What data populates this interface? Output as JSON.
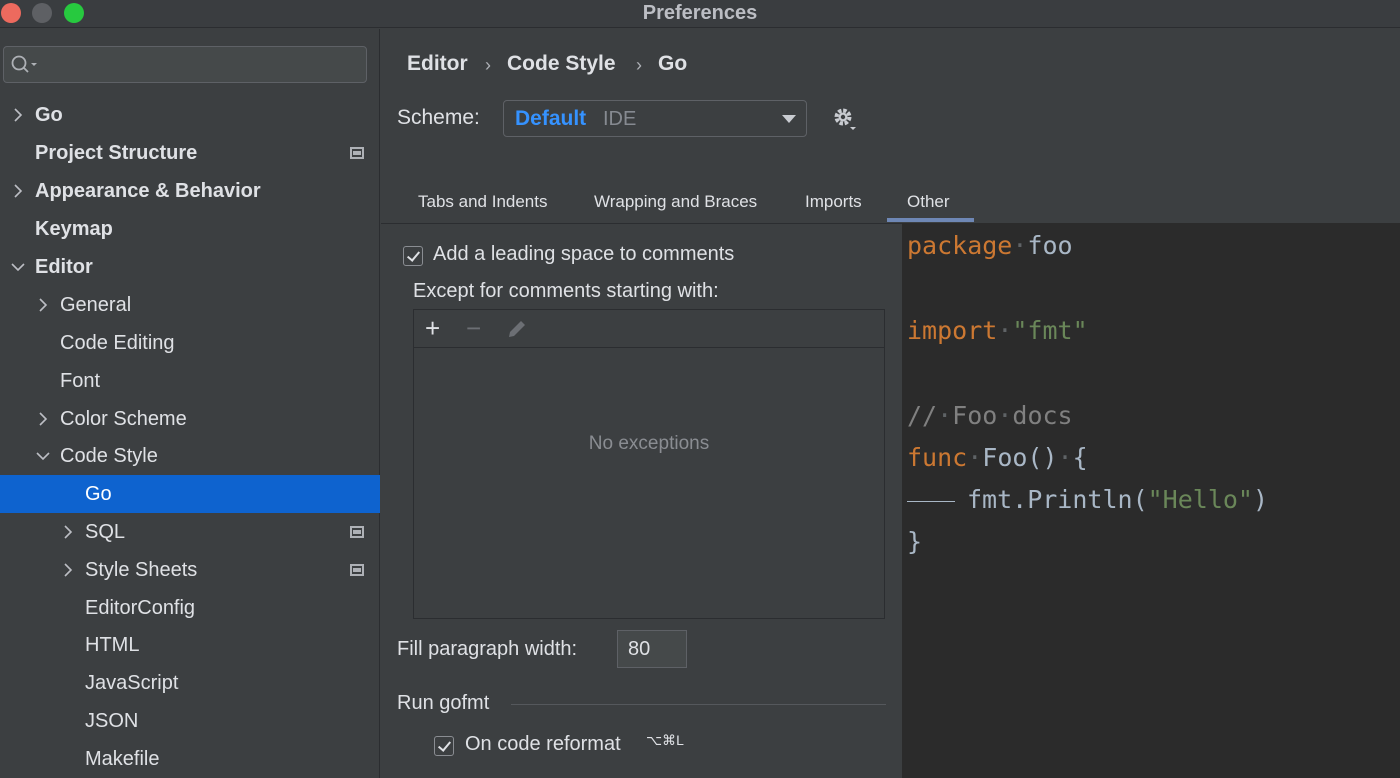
{
  "window": {
    "title": "Preferences"
  },
  "sidebar": {
    "search_placeholder": "",
    "items": [
      {
        "label": "Go"
      },
      {
        "label": "Project Structure"
      },
      {
        "label": "Appearance & Behavior"
      },
      {
        "label": "Keymap"
      },
      {
        "label": "Editor"
      },
      {
        "label": "General"
      },
      {
        "label": "Code Editing"
      },
      {
        "label": "Font"
      },
      {
        "label": "Color Scheme"
      },
      {
        "label": "Code Style"
      },
      {
        "label": "Go"
      },
      {
        "label": "SQL"
      },
      {
        "label": "Style Sheets"
      },
      {
        "label": "EditorConfig"
      },
      {
        "label": "HTML"
      },
      {
        "label": "JavaScript"
      },
      {
        "label": "JSON"
      },
      {
        "label": "Makefile"
      }
    ]
  },
  "breadcrumb": {
    "part1": "Editor",
    "part2": "Code Style",
    "part3": "Go",
    "separator": "›"
  },
  "scheme": {
    "label": "Scheme:",
    "value": "Default",
    "type": "IDE"
  },
  "tabs": [
    {
      "label": "Tabs and Indents"
    },
    {
      "label": "Wrapping and Braces"
    },
    {
      "label": "Imports"
    },
    {
      "label": "Other"
    }
  ],
  "options": {
    "leading_space_label": "Add a leading space to comments",
    "leading_space_checked": true,
    "except_label": "Except for comments starting with:",
    "add_btn": "+",
    "remove_btn": "−",
    "empty_text": "No exceptions",
    "fill_width_label": "Fill paragraph width:",
    "fill_width_value": "80",
    "gofmt_section": "Run gofmt",
    "on_reformat_label": "On code reformat",
    "on_reformat_checked": true,
    "on_reformat_shortcut": "⌥⌘L"
  },
  "preview": {
    "line1_kw": "package",
    "line1_id": "foo",
    "line3_kw": "import",
    "line3_str": "\"fmt\"",
    "line5_comment_slash": "//",
    "line5_comment_text": "Foo",
    "line5_comment_text2": "docs",
    "line6_kw": "func",
    "line6_rest": "Foo()",
    "line6_brace": "{",
    "line7_call": "fmt.Println(",
    "line7_str": "\"Hello\"",
    "line7_close": ")",
    "line8": "}"
  }
}
